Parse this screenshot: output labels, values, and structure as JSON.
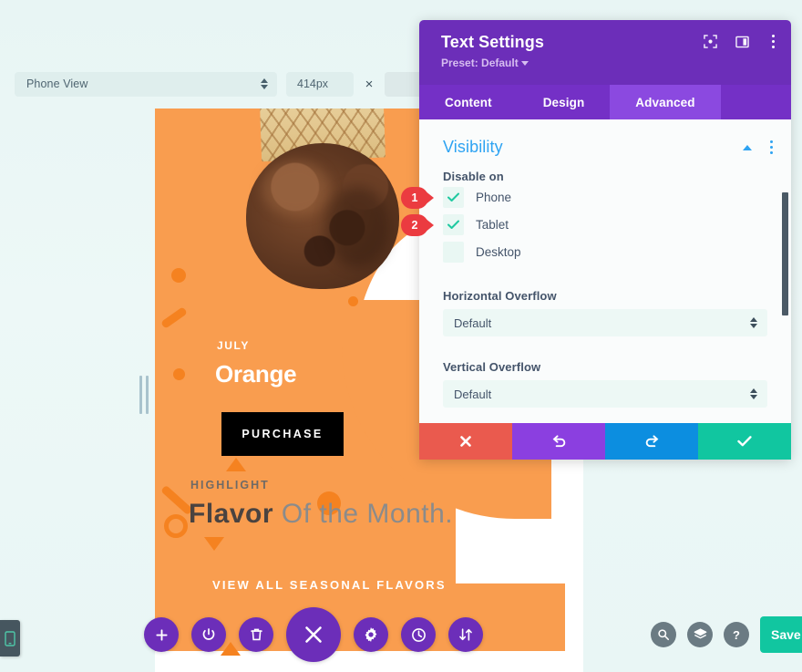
{
  "responsive_toolbar": {
    "view_select": {
      "value": "Phone View",
      "icon": "spinner-icon"
    },
    "width_input": {
      "value": "414px"
    },
    "separator": "×",
    "height_input": {
      "value": ""
    }
  },
  "preview": {
    "subtitle": "JULY",
    "title": "Orange",
    "purchase_button": "PURCHASE",
    "highlight_label": "HIGHLIGHT",
    "headline_bold": "Flavor",
    "headline_rest": " Of the Month.",
    "view_all_button": "VIEW ALL SEASONAL FLAVORS"
  },
  "modal": {
    "title": "Text Settings",
    "preset_label": "Preset: Default",
    "header_icons": [
      {
        "name": "focus-target-icon"
      },
      {
        "name": "split-panel-icon"
      },
      {
        "name": "kebab-menu-icon"
      }
    ],
    "tabs": [
      {
        "label": "Content",
        "active": false
      },
      {
        "label": "Design",
        "active": false
      },
      {
        "label": "Advanced",
        "active": true
      }
    ],
    "section": {
      "title": "Visibility",
      "collapse_icon": "chevron-up-icon",
      "menu_icon": "kebab-menu-icon"
    },
    "disable_on": {
      "label": "Disable on",
      "options": [
        {
          "label": "Phone",
          "checked": true
        },
        {
          "label": "Tablet",
          "checked": true
        },
        {
          "label": "Desktop",
          "checked": false
        }
      ]
    },
    "horizontal_overflow": {
      "label": "Horizontal Overflow",
      "value": "Default"
    },
    "vertical_overflow": {
      "label": "Vertical Overflow",
      "value": "Default"
    },
    "actions": [
      {
        "name": "cancel-button",
        "icon": "close-icon",
        "color": "#ea5a4e"
      },
      {
        "name": "undo-button",
        "icon": "undo-icon",
        "color": "#8b3fe0"
      },
      {
        "name": "redo-button",
        "icon": "redo-icon",
        "color": "#0c8ee0"
      },
      {
        "name": "save-button",
        "icon": "check-icon",
        "color": "#11c6a0"
      }
    ]
  },
  "markers": [
    {
      "number": "1",
      "target": "Phone"
    },
    {
      "number": "2",
      "target": "Tablet"
    }
  ],
  "bottom_bar": {
    "buttons": [
      {
        "name": "add-module-button",
        "icon": "plus-icon"
      },
      {
        "name": "toggle-builder-button",
        "icon": "power-icon"
      },
      {
        "name": "delete-button",
        "icon": "trash-icon"
      },
      {
        "name": "close-menu-button",
        "icon": "close-icon"
      },
      {
        "name": "settings-button",
        "icon": "gear-icon"
      },
      {
        "name": "history-button",
        "icon": "clock-icon"
      },
      {
        "name": "reorder-button",
        "icon": "sort-arrows-icon"
      }
    ]
  },
  "bottom_right": {
    "buttons": [
      {
        "name": "search-button",
        "icon": "search-icon"
      },
      {
        "name": "layers-button",
        "icon": "layers-icon"
      },
      {
        "name": "help-button",
        "icon": "question-mark-icon",
        "glyph": "?"
      }
    ],
    "save_button": "Save"
  },
  "left_tab": {
    "icon": "mobile-phone-icon"
  },
  "colors": {
    "accent_purple": "#6c2eb9",
    "tab_active_purple": "#8b49e0",
    "section_blue": "#2ea3f2",
    "checkbox_teal": "#1ec9a0",
    "marker_red": "#eb3b40",
    "save_teal": "#11c6a0",
    "brand_orange": "#f99d4f"
  }
}
